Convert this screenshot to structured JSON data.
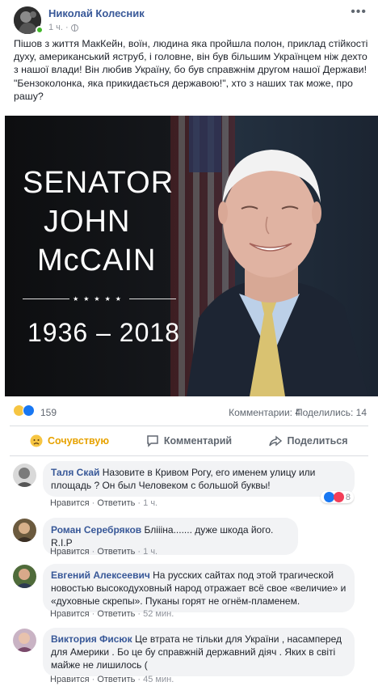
{
  "post": {
    "author": "Николай Колесник",
    "time": "1 ч.",
    "text": "Пішов з життя МакКейн, воїн, людина яка пройшла полон, приклад стійкості духу, американський яструб, і головне, він був більшим Українцем ніж дехто з нашої влади! Він любив Україну, бо був справжнім другом нашої Держави! \"Бензоколонка, яка прикидається державою!\", хто з наших так може, про рашу?"
  },
  "image": {
    "line1": "SENATOR",
    "line2": "JOHN",
    "line3": "McCAIN",
    "years": "1936 – 2018"
  },
  "stats": {
    "reactions": "159",
    "comments": "Комментарии: 4",
    "shares": "Поделились: 14"
  },
  "actions": {
    "react": "Сочувствую",
    "comment": "Комментарий",
    "share": "Поделиться"
  },
  "comments": [
    {
      "name": "Таля Скай",
      "text": "Назовите в Кривом Рогу, его именем улицу или площадь ? Он был Человеком с большой буквы!",
      "like": "Нравится",
      "reply": "Ответить",
      "time": "1 ч.",
      "reacts": "8"
    },
    {
      "name": "Роман Серебряков",
      "text": "Бліііна....... дуже шкода його. R.I.P",
      "like": "Нравится",
      "reply": "Ответить",
      "time": "1 ч."
    },
    {
      "name": "Евгений Алексеевич",
      "text": "На русских сайтах под этой трагической новостью высокодуховный народ отражает всё свое «величие» и «духовные скрепы». Пуканы горят не огнём-пламенем.",
      "like": "Нравится",
      "reply": "Ответить",
      "time": "52 мин."
    },
    {
      "name": "Виктория Фисюк",
      "text": "Це втрата не тільки для України , насамперед для Америки . Бо це бу справжній державний діяч . Яких в світі майже не лишилось (",
      "like": "Нравится",
      "reply": "Ответить",
      "time": "45 мин."
    }
  ],
  "colors": {
    "link": "#385898",
    "muted": "#90949c",
    "bubble": "#f2f3f5",
    "sympathy": "#e7a200"
  }
}
